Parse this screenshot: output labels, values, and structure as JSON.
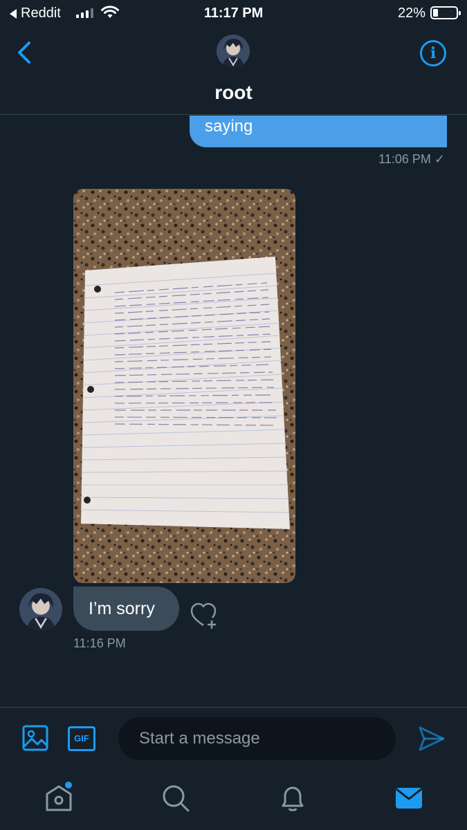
{
  "status_bar": {
    "back_app": "Reddit",
    "time": "11:17 PM",
    "battery_percent": "22%",
    "battery_level": 0.22,
    "signal_bars": 3
  },
  "header": {
    "title": "root",
    "back_icon": "chevron-left-icon",
    "info_icon": "info-icon",
    "info_glyph": "i"
  },
  "messages": {
    "sent": {
      "text": "saying",
      "time": "11:06 PM",
      "status_glyph": "✓"
    },
    "received_text": {
      "text": "I’m sorry",
      "time": "11:16 PM"
    }
  },
  "composer": {
    "gif_label": "GIF",
    "placeholder": "Start a message"
  },
  "nav": {
    "items": [
      "home-icon",
      "search-icon",
      "notifications-icon",
      "messages-icon"
    ],
    "active": "messages-icon"
  },
  "colors": {
    "background": "#15202b",
    "accent": "#1d9bf0",
    "sent_bubble": "#4a9fe8",
    "received_bubble": "#3c4b5a",
    "muted_text": "#8b98a5"
  }
}
